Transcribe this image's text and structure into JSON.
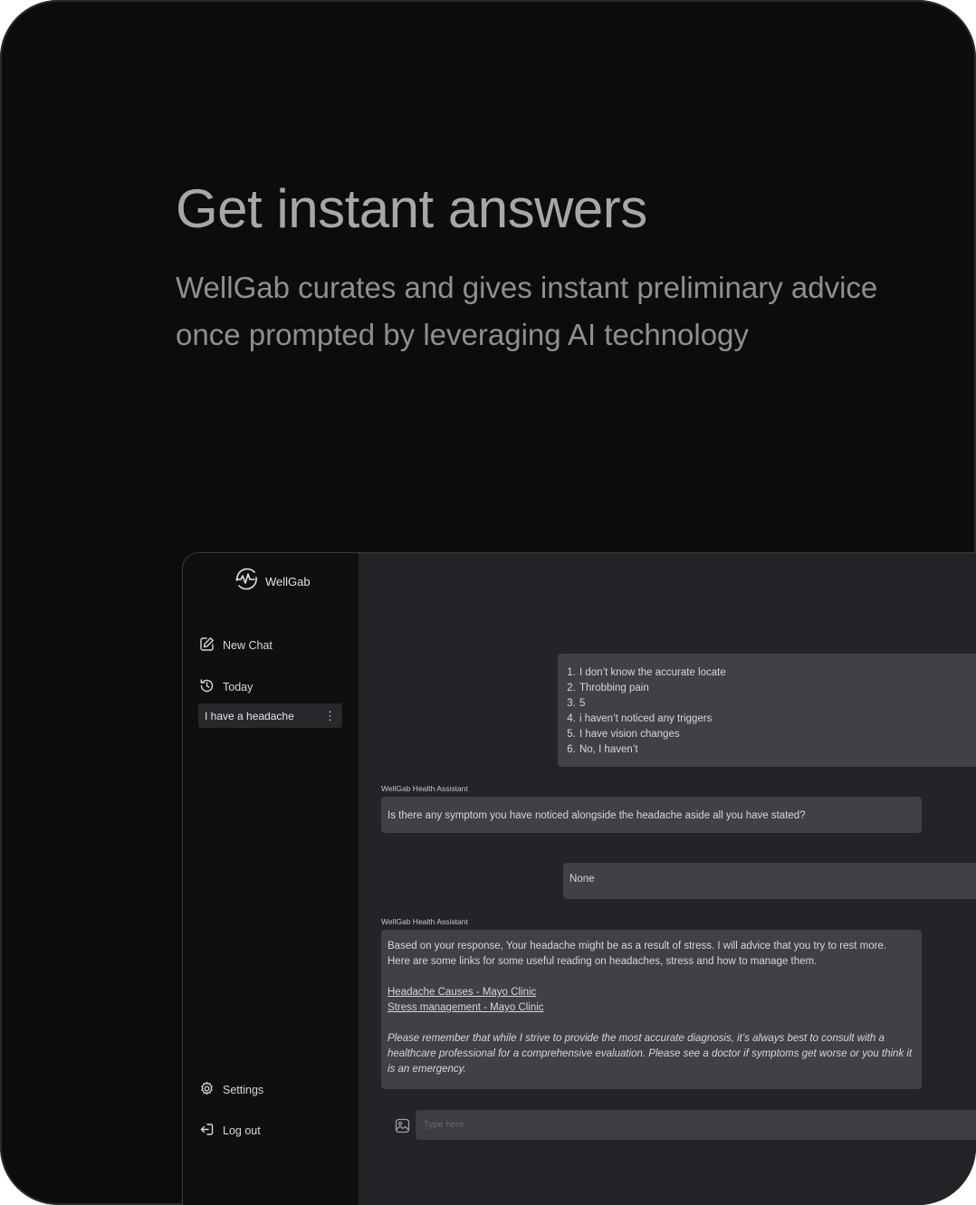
{
  "hero": {
    "title": "Get instant answers",
    "subtitle_line1": "WellGab curates and gives instant preliminary advice",
    "subtitle_line2": "once prompted by leveraging AI technology"
  },
  "sidebar": {
    "brand": "WellGab",
    "new_chat": "New Chat",
    "today": "Today",
    "chat_title": "I have a headache",
    "settings": "Settings",
    "logout": "Log out"
  },
  "conversation": {
    "user_answers": [
      "I don’t know the accurate locate",
      "Throbbing pain",
      "5",
      "i haven’t noticed any triggers",
      "I have vision changes",
      "No, I haven’t"
    ],
    "assistant_name": "WellGab Health Assistant",
    "assistant_question": "Is there any symptom you have noticed alongside the headache aside all you have stated?",
    "user_reply": "None",
    "assistant_response": {
      "line1": "Based on your response, Your headache might be as a result of stress. I will advice that you try to rest more.",
      "line2": "Here are some links for some useful reading on headaches, stress and how to manage them.",
      "link1": "Headache Causes - Mayo Clinic",
      "link2": "Stress management - Mayo Clinic",
      "disclaimer": "Please remember that while I strive to provide the most accurate diagnosis, it’s always best to consult with a healthcare professional for a comprehensive evaluation. Please see a doctor if symptoms get worse or you think it is an emergency."
    }
  },
  "composer": {
    "placeholder": "Type here"
  }
}
